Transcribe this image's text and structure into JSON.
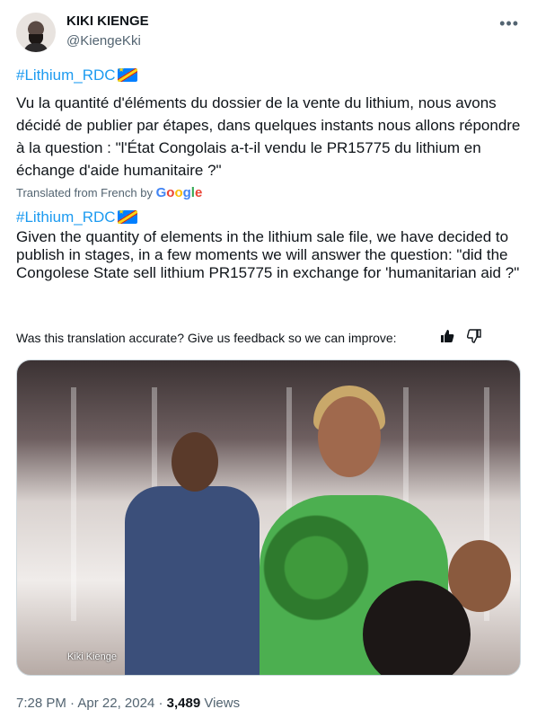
{
  "author": {
    "display_name": "KIKI KIENGE",
    "handle": "@KiengeKki",
    "more_icon": "more-horizontal-icon"
  },
  "tweet": {
    "hashtag": "#Lithium_RDC",
    "hashtag_emoji": "flag-drc-icon",
    "text_fr": "Vu la quantité d'éléments du dossier de la vente du lithium, nous avons décidé de publier par étapes, dans quelques instants nous allons répondre à la question : \"l'État Congolais a-t-il vendu le PR15775 du lithium en échange d'aide humanitaire ?\"",
    "translated_label": "Translated from French by",
    "translated_provider": "Google",
    "hashtag_en": "#Lithium_RDC",
    "text_en": "Given the quantity of elements in the lithium sale file, we have decided to publish in stages, in a few moments we will answer the question: \"did the Congolese State sell lithium PR15775 in exchange for 'humanitarian aid ?\""
  },
  "feedback": {
    "prompt": "Was this translation accurate? Give us feedback so we can improve:",
    "thumbs_up_icon": "thumbs-up-icon",
    "thumbs_down_icon": "thumbs-down-icon"
  },
  "photo": {
    "watermark": "Kiki Kienge"
  },
  "meta": {
    "time": "7:28 PM",
    "date": "Apr 22, 2024",
    "views_count": "3,489",
    "views_label": "Views"
  },
  "colors": {
    "link": "#1d9bf0",
    "secondary_text": "#536471",
    "primary_text": "#0f1419"
  }
}
